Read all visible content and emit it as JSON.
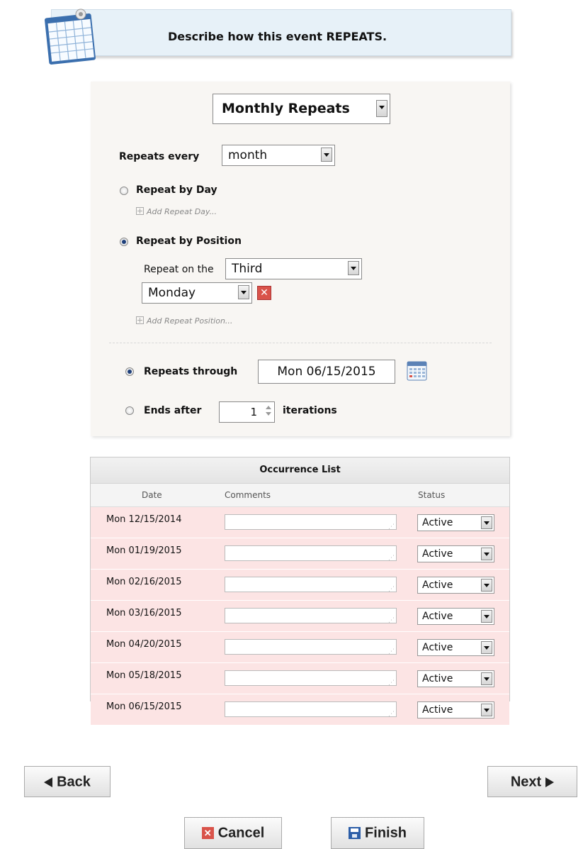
{
  "header": {
    "title": "Describe how this event REPEATS."
  },
  "repeat": {
    "type_select": "Monthly Repeats",
    "repeats_every_label": "Repeats every",
    "repeats_every_value": "month",
    "by_day_label": "Repeat by Day",
    "add_day_link": "Add Repeat Day...",
    "by_position_label": "Repeat by Position",
    "repeat_on_label": "Repeat on the",
    "position_value": "Third",
    "weekday_value": "Monday",
    "delete_symbol": "✕",
    "add_position_link": "Add Repeat Position...",
    "through_label": "Repeats through",
    "through_date": "Mon 06/15/2015",
    "ends_after_label": "Ends after",
    "ends_after_count": "1",
    "iterations_label": "iterations",
    "selected_mode": "Repeat by Position",
    "selected_end": "Repeats through"
  },
  "occurrences": {
    "title": "Occurrence List",
    "headers": {
      "date": "Date",
      "comments": "Comments",
      "status": "Status"
    },
    "rows": [
      {
        "date": "Mon 12/15/2014",
        "status": "Active"
      },
      {
        "date": "Mon 01/19/2015",
        "status": "Active"
      },
      {
        "date": "Mon 02/16/2015",
        "status": "Active"
      },
      {
        "date": "Mon 03/16/2015",
        "status": "Active"
      },
      {
        "date": "Mon 04/20/2015",
        "status": "Active"
      },
      {
        "date": "Mon 05/18/2015",
        "status": "Active"
      },
      {
        "date": "Mon 06/15/2015",
        "status": "Active"
      }
    ],
    "row_color": "#fce4e4"
  },
  "nav": {
    "back_label": "Back",
    "next_label": "Next",
    "cancel_label": "Cancel",
    "finish_label": "Finish"
  },
  "icons": {
    "header_icon": "calendar-icon",
    "date_picker": "calendar-icon",
    "cancel": "close-icon",
    "finish": "save-icon"
  },
  "colors": {
    "banner": "#e7f1f8",
    "panel": "#f8f6f3",
    "delete": "#d9534a",
    "save": "#2c5ea8"
  }
}
